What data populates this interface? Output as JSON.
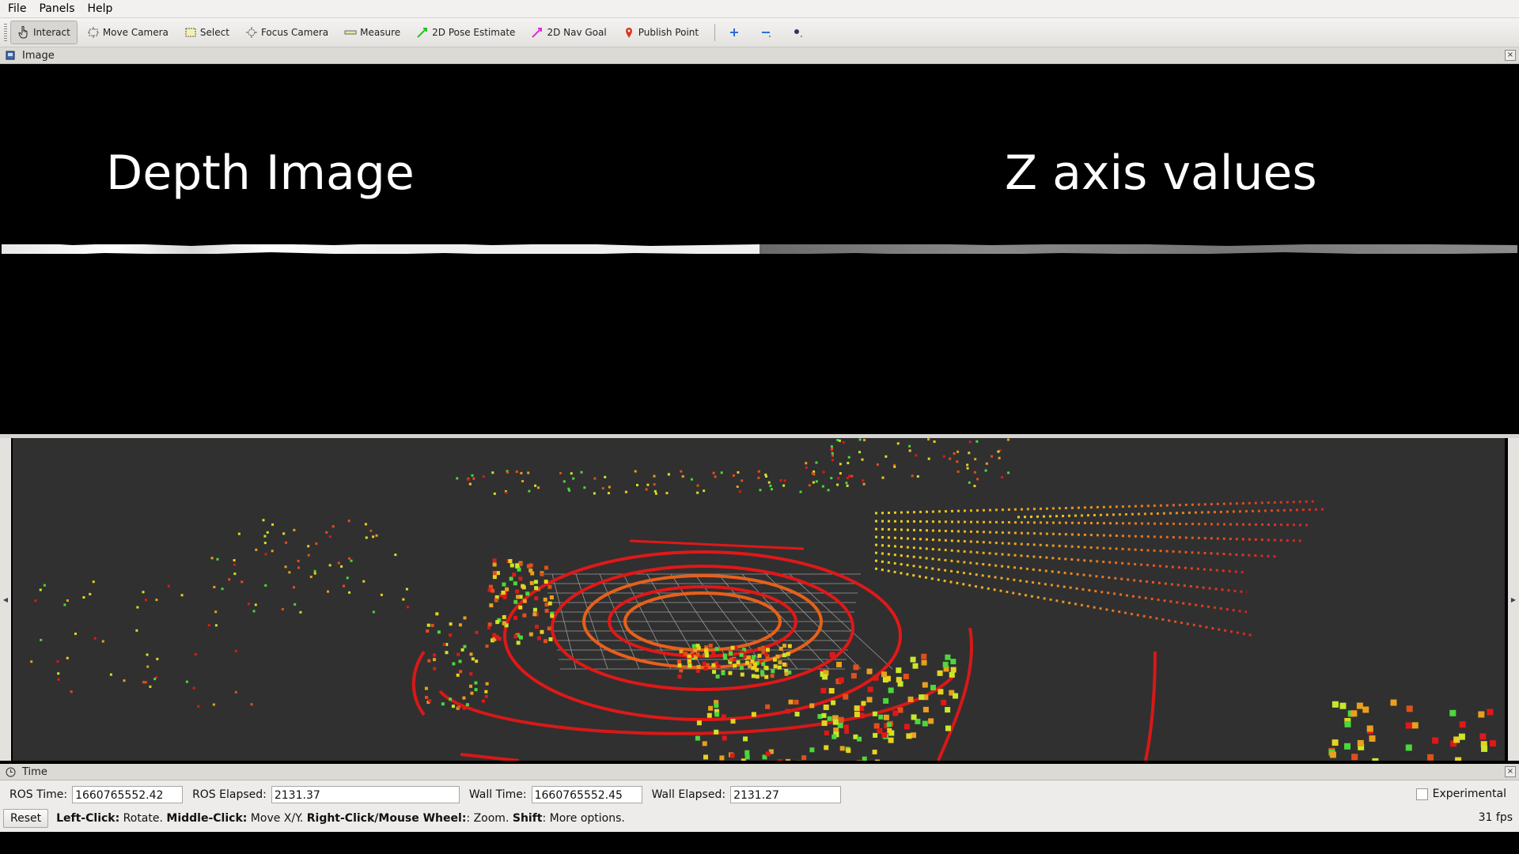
{
  "menu": [
    {
      "label": "File"
    },
    {
      "label": "Panels"
    },
    {
      "label": "Help"
    }
  ],
  "toolbar": {
    "tools": [
      {
        "label": "Interact",
        "icon": "hand-pointer-icon",
        "active": true
      },
      {
        "label": "Move Camera",
        "icon": "move-camera-icon"
      },
      {
        "label": "Select",
        "icon": "select-box-icon"
      },
      {
        "label": "Focus Camera",
        "icon": "focus-camera-icon"
      },
      {
        "label": "Measure",
        "icon": "ruler-icon"
      },
      {
        "label": "2D Pose Estimate",
        "icon": "green-arrow-icon",
        "color": "#22c422"
      },
      {
        "label": "2D Nav Goal",
        "icon": "pink-arrow-icon",
        "color": "#e22ad8"
      },
      {
        "label": "Publish Point",
        "icon": "map-pin-icon",
        "color": "#d9381e"
      }
    ]
  },
  "image_panel": {
    "title": "Image",
    "left_label": "Depth Image",
    "right_label": "Z axis values"
  },
  "time_panel": {
    "title": "Time",
    "ros_time_label": "ROS Time:",
    "ros_time": "1660765552.42",
    "ros_elapsed_label": "ROS Elapsed:",
    "ros_elapsed": "2131.37",
    "wall_time_label": "Wall Time:",
    "wall_time": "1660765552.45",
    "wall_elapsed_label": "Wall Elapsed:",
    "wall_elapsed": "2131.27",
    "experimental_label": "Experimental",
    "experimental_checked": false
  },
  "status_bar": {
    "reset_label": "Reset",
    "hint_parts": [
      {
        "text": "Left-Click:",
        "bold": true
      },
      {
        "text": " Rotate. ",
        "bold": false
      },
      {
        "text": "Middle-Click:",
        "bold": true
      },
      {
        "text": " Move X/Y. ",
        "bold": false
      },
      {
        "text": "Right-Click/Mouse Wheel:",
        "bold": true
      },
      {
        "text": ": Zoom. ",
        "bold": false
      },
      {
        "text": "Shift",
        "bold": true
      },
      {
        "text": ": More options.",
        "bold": false
      }
    ],
    "fps": "31 fps"
  },
  "colors": {
    "viewport_bg": "#303030",
    "grid": "#a0a0a0",
    "ring_red": "#e01818",
    "ring_orange": "#e8601a",
    "points_yellow": "#e8d21e",
    "points_green": "#4ad83a"
  }
}
